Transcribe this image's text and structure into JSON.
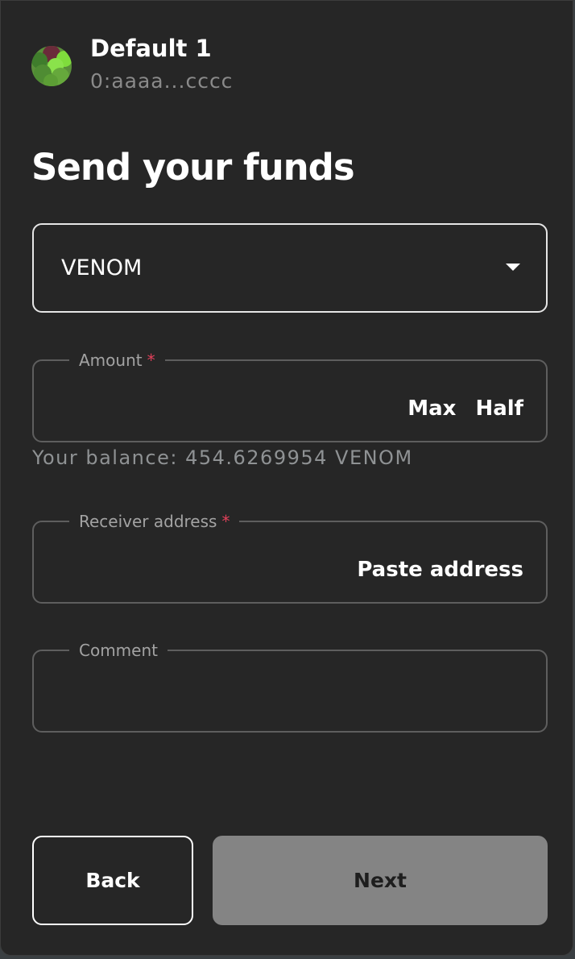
{
  "account": {
    "name": "Default 1",
    "address": "0:aaaa...cccc"
  },
  "page_title": "Send your funds",
  "token_select": {
    "value": "VENOM"
  },
  "amount_field": {
    "label": "Amount",
    "required_mark": "*",
    "value": "",
    "max_label": "Max",
    "half_label": "Half"
  },
  "balance_text": "Your balance: 454.6269954 VENOM",
  "receiver_field": {
    "label": "Receiver address",
    "required_mark": "*",
    "value": "",
    "paste_label": "Paste address"
  },
  "comment_field": {
    "label": "Comment",
    "value": ""
  },
  "buttons": {
    "back_label": "Back",
    "next_label": "Next"
  },
  "colors": {
    "panel_background": "#262626",
    "required_mark": "#e2405a",
    "next_disabled": "#848484"
  },
  "icons": {
    "avatar": "account-avatar",
    "dropdown": "chevron-down-icon"
  }
}
